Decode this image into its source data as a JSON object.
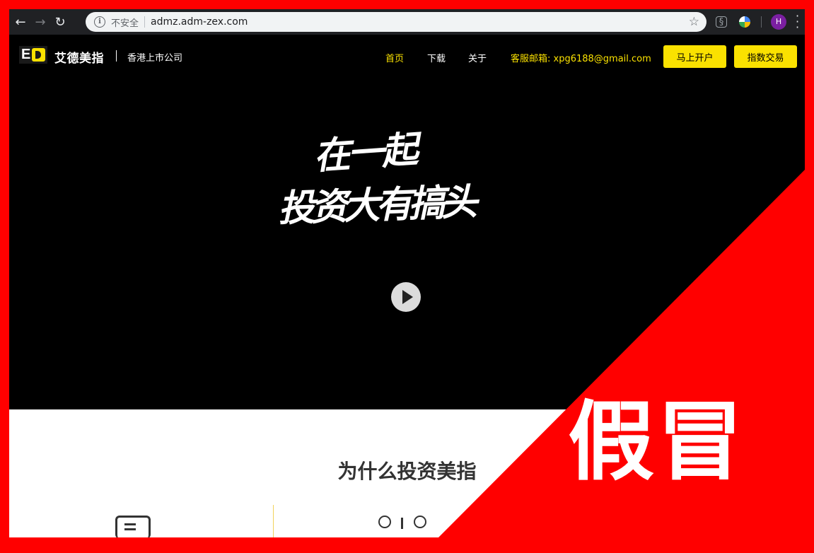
{
  "browser": {
    "security_label": "不安全",
    "url": "admz.adm-zex.com",
    "avatar_letter": "H"
  },
  "site": {
    "logo_text": "E",
    "brand_name": "艾德美指",
    "tagline": "香港上市公司",
    "nav": {
      "home": "首页",
      "download": "下载",
      "about": "关于",
      "contact": "客服邮箱: xpg6188@gmail.com"
    },
    "buttons": {
      "open_account": "马上开户",
      "index_trading": "指数交易"
    },
    "accent_color": "#fae100"
  },
  "hero": {
    "slogan_line1": "在一起",
    "slogan_line2": "投资大有搞头"
  },
  "section": {
    "title": "为什么投资美指"
  },
  "overlay": {
    "warning_text": "假冒",
    "color": "#ff0000"
  }
}
